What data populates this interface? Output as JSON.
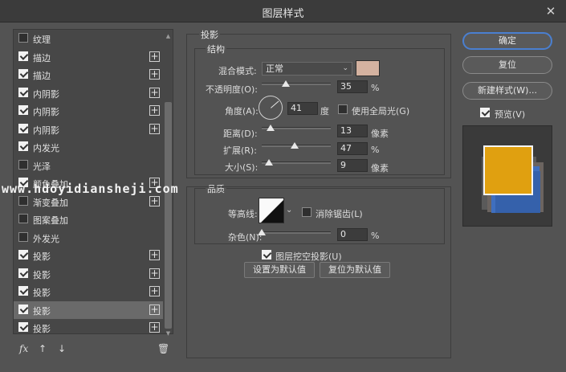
{
  "window": {
    "title": "图层样式",
    "close_label": "✕"
  },
  "styles": [
    {
      "label": "纹理",
      "checked": false,
      "plus": false,
      "selected": false
    },
    {
      "label": "描边",
      "checked": true,
      "plus": true,
      "selected": false
    },
    {
      "label": "描边",
      "checked": true,
      "plus": true,
      "selected": false
    },
    {
      "label": "内阴影",
      "checked": true,
      "plus": true,
      "selected": false
    },
    {
      "label": "内阴影",
      "checked": true,
      "plus": true,
      "selected": false
    },
    {
      "label": "内阴影",
      "checked": true,
      "plus": true,
      "selected": false
    },
    {
      "label": "内发光",
      "checked": true,
      "plus": false,
      "selected": false
    },
    {
      "label": "光泽",
      "checked": false,
      "plus": false,
      "selected": false
    },
    {
      "label": "颜色叠加",
      "checked": true,
      "plus": true,
      "selected": false
    },
    {
      "label": "渐变叠加",
      "checked": false,
      "plus": true,
      "selected": false
    },
    {
      "label": "图案叠加",
      "checked": false,
      "plus": false,
      "selected": false
    },
    {
      "label": "外发光",
      "checked": false,
      "plus": false,
      "selected": false
    },
    {
      "label": "投影",
      "checked": true,
      "plus": true,
      "selected": false
    },
    {
      "label": "投影",
      "checked": true,
      "plus": true,
      "selected": false
    },
    {
      "label": "投影",
      "checked": true,
      "plus": true,
      "selected": false
    },
    {
      "label": "投影",
      "checked": true,
      "plus": true,
      "selected": true
    },
    {
      "label": "投影",
      "checked": true,
      "plus": true,
      "selected": false
    }
  ],
  "bottom_tools": {
    "fx": "fx",
    "up": "↑",
    "down": "↓",
    "trash": "🗑"
  },
  "shadow": {
    "section_title": "投影",
    "structure_title": "结构",
    "blend_mode_label": "混合模式:",
    "blend_mode_value": "正常",
    "swatch_color": "#d4b2a0",
    "opacity_label": "不透明度(O):",
    "opacity_value": "35",
    "opacity_unit": "%",
    "opacity_fraction": 0.35,
    "angle_label": "角度(A):",
    "angle_value": "41",
    "angle_unit": "度",
    "global_light_label": "使用全局光(G)",
    "global_light_checked": false,
    "distance_label": "距离(D):",
    "distance_value": "13",
    "distance_unit": "像素",
    "spread_label": "扩展(R):",
    "spread_value": "47",
    "spread_unit": "%",
    "size_label": "大小(S):",
    "size_value": "9",
    "size_unit": "像素",
    "quality_title": "品质",
    "contour_label": "等高线:",
    "antialias_label": "消除锯齿(L)",
    "antialias_checked": false,
    "noise_label": "杂色(N):",
    "noise_value": "0",
    "noise_unit": "%",
    "knockout_label": "图层挖空投影(U)",
    "knockout_checked": true,
    "set_default_label": "设置为默认值",
    "reset_default_label": "复位为默认值"
  },
  "right": {
    "ok_label": "确定",
    "reset_label": "复位",
    "new_style_label": "新建样式(W)...",
    "preview_label": "预览(V)",
    "preview_checked": true,
    "preview_fill": "#e0a010"
  },
  "watermark": "www.hdoyidiansheji.com"
}
